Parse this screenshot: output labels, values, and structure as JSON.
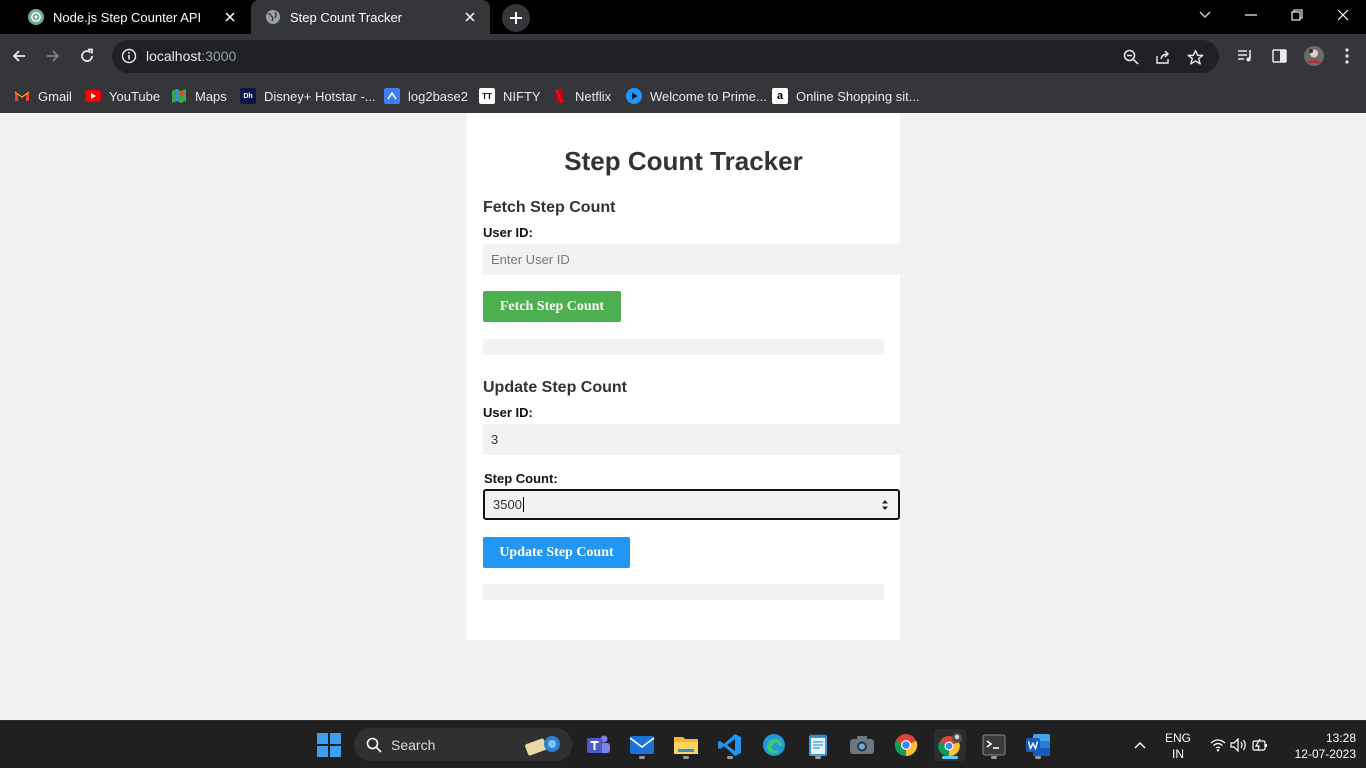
{
  "browser": {
    "tabs": [
      {
        "title": "Node.js Step Counter API",
        "active": false
      },
      {
        "title": "Step Count Tracker",
        "active": true
      }
    ],
    "address": {
      "host": "localhost",
      "port": ":3000"
    },
    "bookmarks": [
      {
        "label": "Gmail",
        "icon": "gmail-icon"
      },
      {
        "label": "YouTube",
        "icon": "youtube-icon"
      },
      {
        "label": "Maps",
        "icon": "maps-icon"
      },
      {
        "label": "Disney+ Hotstar -...",
        "icon": "hotstar-icon"
      },
      {
        "label": "log2base2",
        "icon": "log2base2-icon"
      },
      {
        "label": "NIFTY",
        "icon": "nifty-icon"
      },
      {
        "label": "Netflix",
        "icon": "netflix-icon"
      },
      {
        "label": "Welcome to Prime...",
        "icon": "prime-video-icon"
      },
      {
        "label": "Online Shopping sit...",
        "icon": "amazon-icon"
      }
    ]
  },
  "page": {
    "title": "Step Count Tracker",
    "fetch": {
      "heading": "Fetch Step Count",
      "user_id_label": "User ID:",
      "user_id_placeholder": "Enter User ID",
      "button_label": "Fetch Step Count",
      "result": ""
    },
    "update": {
      "heading": "Update Step Count",
      "user_id_label": "User ID:",
      "user_id_value": "3",
      "step_count_label": "Step Count:",
      "step_count_value": "3500",
      "button_label": "Update Step Count",
      "result": ""
    }
  },
  "taskbar": {
    "search_label": "Search",
    "language": "ENG",
    "region": "IN",
    "time": "13:28",
    "date": "12-07-2023"
  },
  "colors": {
    "fetch_button": "#4caf50",
    "update_button": "#2196f3",
    "page_background": "#f2f2f2",
    "browser_chrome": "#35363a"
  }
}
